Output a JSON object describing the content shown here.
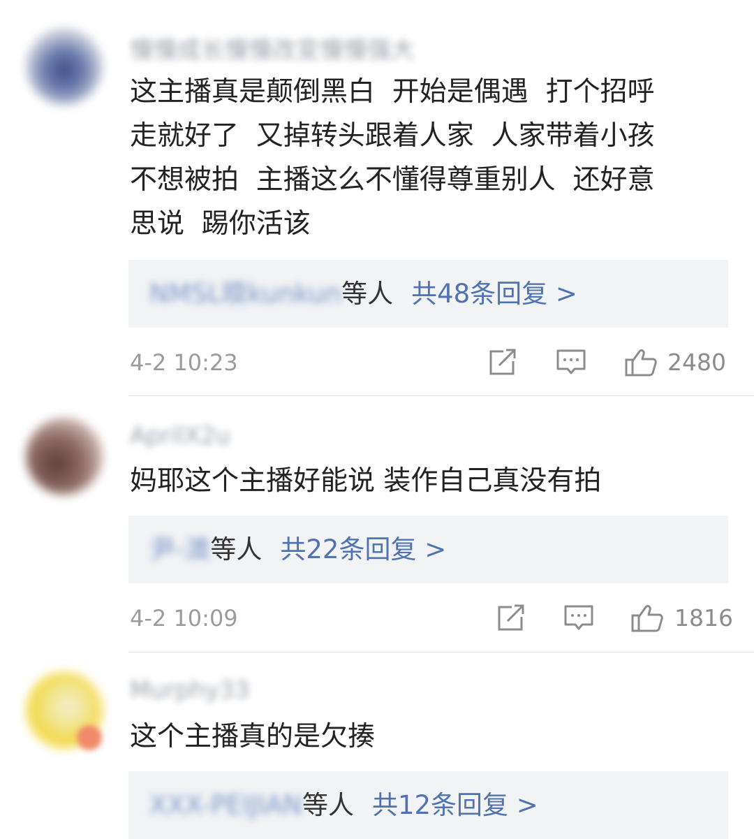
{
  "comments": [
    {
      "username": "慢慢成长慢慢改变慢慢强大",
      "text": "这主播真是颠倒黑白  开始是偶遇  打个招呼\n走就好了  又掉转头跟着人家  人家带着小孩\n不想被拍  主播这么不懂得尊重别人  还好意\n思说  踢你活该",
      "reply_names": "NMSL㬉kunkun",
      "reply_etc": "等人",
      "reply_count": "共48条回复 >",
      "time": "4-2 10:23",
      "likes": "2480"
    },
    {
      "username": "AprilX2u",
      "text": "妈耶这个主播好能说 装作自己真没有拍",
      "reply_names": "尹-澳",
      "reply_etc": "等人",
      "reply_count": "共22条回复 >",
      "time": "4-2 10:09",
      "likes": "1816"
    },
    {
      "username": "Murphy33",
      "text": "这个主播真的是欠揍",
      "reply_names": "XXX-PEIJIAN",
      "reply_etc": "等人",
      "reply_count": "共12条回复 >"
    }
  ],
  "icons": [
    "share-icon",
    "comment-icon",
    "like-icon"
  ],
  "colors": {
    "link": "#4f73b0",
    "reply_bg": "#f2f3f5",
    "text": "#222222",
    "meta": "#9b9b9b"
  }
}
